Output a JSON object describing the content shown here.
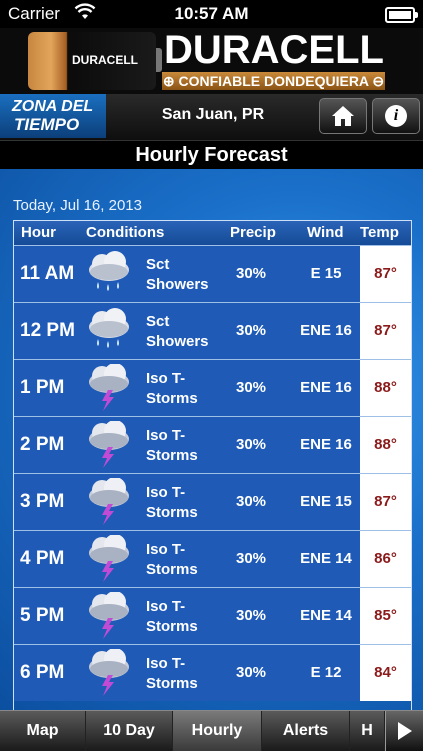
{
  "status_bar": {
    "carrier": "Carrier",
    "time": "10:57 AM"
  },
  "ad": {
    "battery_label": "DURACELL",
    "brand": "DURACELL",
    "tagline": "⊕ CONFIABLE DONDEQUIERA ⊖"
  },
  "header": {
    "logo_line1": "ZONA DEL",
    "logo_line2": "TIEMPO",
    "location": "San Juan, PR",
    "home_icon": "home-icon",
    "info_icon": "info-icon"
  },
  "title": "Hourly Forecast",
  "date": "Today, Jul 16, 2013",
  "columns": {
    "hour": "Hour",
    "conditions": "Conditions",
    "precip": "Precip",
    "wind": "Wind",
    "temp": "Temp"
  },
  "rows": [
    {
      "hour": "11 AM",
      "icon": "showers-icon",
      "conditions": "Sct Showers",
      "precip": "30%",
      "wind": "E 15",
      "temp": "87°"
    },
    {
      "hour": "12 PM",
      "icon": "showers-icon",
      "conditions": "Sct Showers",
      "precip": "30%",
      "wind": "ENE 16",
      "temp": "87°"
    },
    {
      "hour": "1 PM",
      "icon": "thunderstorm-icon",
      "conditions": "Iso T-Storms",
      "precip": "30%",
      "wind": "ENE 16",
      "temp": "88°"
    },
    {
      "hour": "2 PM",
      "icon": "thunderstorm-icon",
      "conditions": "Iso T-Storms",
      "precip": "30%",
      "wind": "ENE 16",
      "temp": "88°"
    },
    {
      "hour": "3 PM",
      "icon": "thunderstorm-icon",
      "conditions": "Iso T-Storms",
      "precip": "30%",
      "wind": "ENE 15",
      "temp": "87°"
    },
    {
      "hour": "4 PM",
      "icon": "thunderstorm-icon",
      "conditions": "Iso T-Storms",
      "precip": "30%",
      "wind": "ENE 14",
      "temp": "86°"
    },
    {
      "hour": "5 PM",
      "icon": "thunderstorm-icon",
      "conditions": "Iso T-Storms",
      "precip": "30%",
      "wind": "ENE 14",
      "temp": "85°"
    },
    {
      "hour": "6 PM",
      "icon": "thunderstorm-icon",
      "conditions": "Iso T-Storms",
      "precip": "30%",
      "wind": "E 12",
      "temp": "84°"
    }
  ],
  "tabs": [
    {
      "label": "Map"
    },
    {
      "label": "10 Day"
    },
    {
      "label": "Hourly",
      "active": true
    },
    {
      "label": "Alerts"
    },
    {
      "label": "H"
    }
  ],
  "colors": {
    "background_blue": "#1a6fc8",
    "temp_red": "#8b1a1a",
    "row_blue": "#1e5ab6"
  }
}
